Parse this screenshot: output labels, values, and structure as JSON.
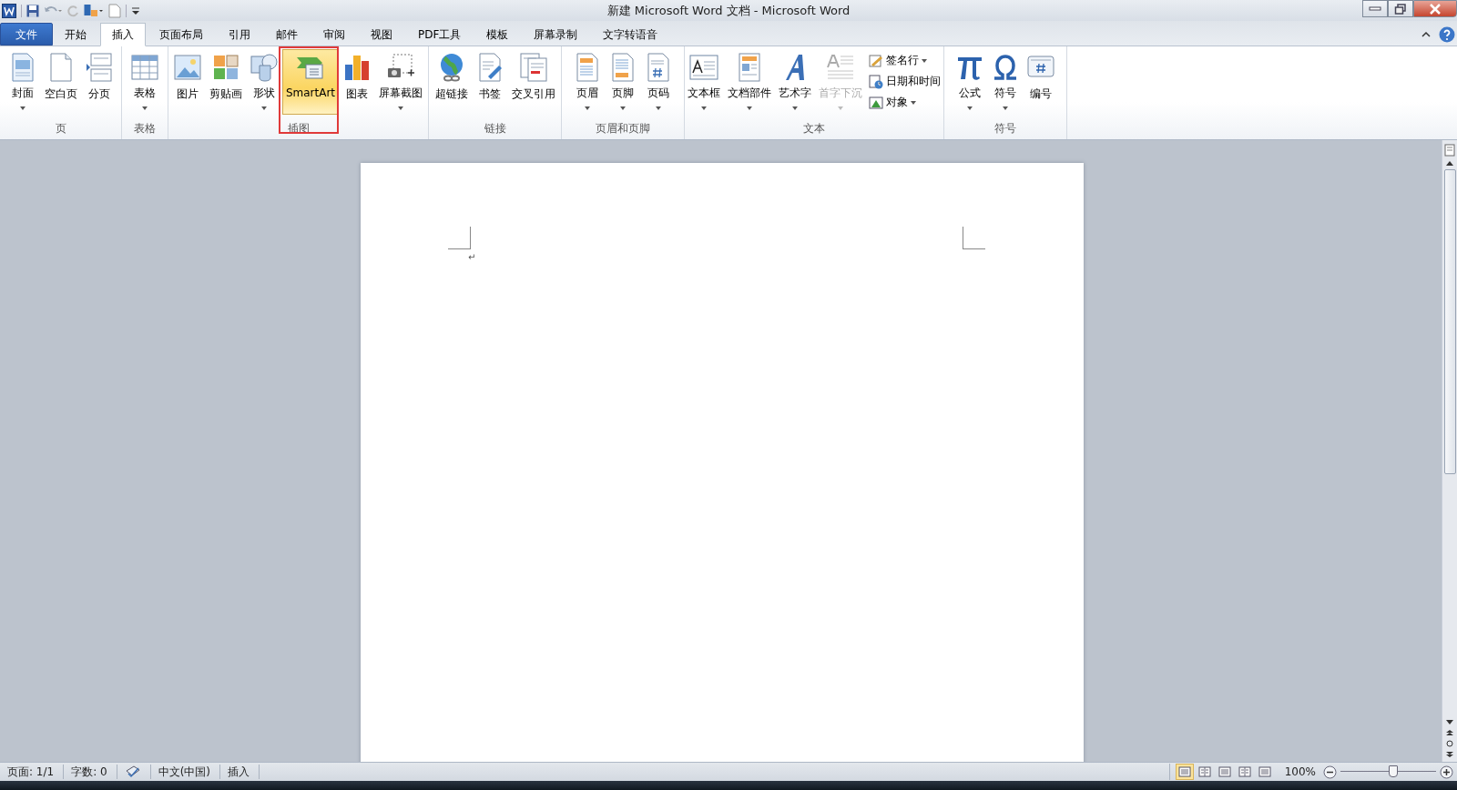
{
  "window": {
    "title": "新建 Microsoft Word 文档 - Microsoft Word"
  },
  "tabs": [
    {
      "label": "文件",
      "kind": "file",
      "selected": false
    },
    {
      "label": "开始",
      "kind": "tab",
      "selected": false
    },
    {
      "label": "插入",
      "kind": "tab",
      "selected": true
    },
    {
      "label": "页面布局",
      "kind": "tab",
      "selected": false
    },
    {
      "label": "引用",
      "kind": "tab",
      "selected": false
    },
    {
      "label": "邮件",
      "kind": "tab",
      "selected": false
    },
    {
      "label": "审阅",
      "kind": "tab",
      "selected": false
    },
    {
      "label": "视图",
      "kind": "tab",
      "selected": false
    },
    {
      "label": "PDF工具",
      "kind": "tab",
      "selected": false
    },
    {
      "label": "模板",
      "kind": "tab",
      "selected": false
    },
    {
      "label": "屏幕录制",
      "kind": "tab",
      "selected": false
    },
    {
      "label": "文字转语音",
      "kind": "tab",
      "selected": false
    }
  ],
  "ribbon": {
    "groups": [
      {
        "label": "页",
        "commands": [
          {
            "label": "封面",
            "kind": "large",
            "dropdown": true,
            "disabled": false,
            "highlighted": false
          },
          {
            "label": "空白页",
            "kind": "large",
            "dropdown": false,
            "disabled": false,
            "highlighted": false
          },
          {
            "label": "分页",
            "kind": "large",
            "dropdown": false,
            "disabled": false,
            "highlighted": false
          }
        ]
      },
      {
        "label": "表格",
        "commands": [
          {
            "label": "表格",
            "kind": "large",
            "dropdown": true,
            "disabled": false,
            "highlighted": false
          }
        ]
      },
      {
        "label": "插图",
        "commands": [
          {
            "label": "图片",
            "kind": "large",
            "dropdown": false,
            "disabled": false,
            "highlighted": false
          },
          {
            "label": "剪贴画",
            "kind": "large",
            "dropdown": false,
            "disabled": false,
            "highlighted": false
          },
          {
            "label": "形状",
            "kind": "large",
            "dropdown": true,
            "disabled": false,
            "highlighted": false
          },
          {
            "label": "SmartArt",
            "kind": "large",
            "dropdown": false,
            "disabled": false,
            "highlighted": true
          },
          {
            "label": "图表",
            "kind": "large",
            "dropdown": false,
            "disabled": false,
            "highlighted": false
          },
          {
            "label": "屏幕截图",
            "kind": "large",
            "dropdown": true,
            "disabled": false,
            "highlighted": false
          }
        ]
      },
      {
        "label": "链接",
        "commands": [
          {
            "label": "超链接",
            "kind": "large",
            "dropdown": false,
            "disabled": false,
            "highlighted": false
          },
          {
            "label": "书签",
            "kind": "large",
            "dropdown": false,
            "disabled": false,
            "highlighted": false
          },
          {
            "label": "交叉引用",
            "kind": "large",
            "dropdown": false,
            "disabled": false,
            "highlighted": false
          }
        ]
      },
      {
        "label": "页眉和页脚",
        "commands": [
          {
            "label": "页眉",
            "kind": "large",
            "dropdown": true,
            "disabled": false,
            "highlighted": false
          },
          {
            "label": "页脚",
            "kind": "large",
            "dropdown": true,
            "disabled": false,
            "highlighted": false
          },
          {
            "label": "页码",
            "kind": "large",
            "dropdown": true,
            "disabled": false,
            "highlighted": false
          }
        ]
      },
      {
        "label": "文本",
        "commands": [
          {
            "label": "文本框",
            "kind": "large",
            "dropdown": true,
            "disabled": false,
            "highlighted": false
          },
          {
            "label": "文档部件",
            "kind": "large",
            "dropdown": true,
            "disabled": false,
            "highlighted": false
          },
          {
            "label": "艺术字",
            "kind": "large",
            "dropdown": true,
            "disabled": false,
            "highlighted": false
          },
          {
            "label": "首字下沉",
            "kind": "large",
            "dropdown": true,
            "disabled": true,
            "highlighted": false
          },
          {
            "label": "签名行",
            "kind": "small",
            "dropdown": true,
            "disabled": false,
            "highlighted": false
          },
          {
            "label": "日期和时间",
            "kind": "small",
            "dropdown": false,
            "disabled": false,
            "highlighted": false
          },
          {
            "label": "对象",
            "kind": "small",
            "dropdown": true,
            "disabled": false,
            "highlighted": false
          }
        ]
      },
      {
        "label": "符号",
        "commands": [
          {
            "label": "公式",
            "kind": "large",
            "dropdown": true,
            "disabled": false,
            "highlighted": false
          },
          {
            "label": "符号",
            "kind": "large",
            "dropdown": true,
            "disabled": false,
            "highlighted": false
          },
          {
            "label": "编号",
            "kind": "large",
            "dropdown": false,
            "disabled": false,
            "highlighted": false
          }
        ]
      }
    ]
  },
  "document": {
    "paragraph_mark": "↵"
  },
  "status_bar": {
    "items": [
      {
        "label": "页面: 1/1",
        "kind": "text"
      },
      {
        "label": "字数: 0",
        "kind": "text"
      },
      {
        "kind": "proofing"
      },
      {
        "label": "中文(中国)",
        "kind": "text"
      },
      {
        "label": "插入",
        "kind": "text"
      }
    ],
    "views": [
      {
        "selected": true
      },
      {
        "selected": false
      },
      {
        "selected": false
      },
      {
        "selected": false
      },
      {
        "selected": false
      }
    ],
    "zoom": "100%",
    "zoom_slider": {
      "level": 0.55
    }
  }
}
